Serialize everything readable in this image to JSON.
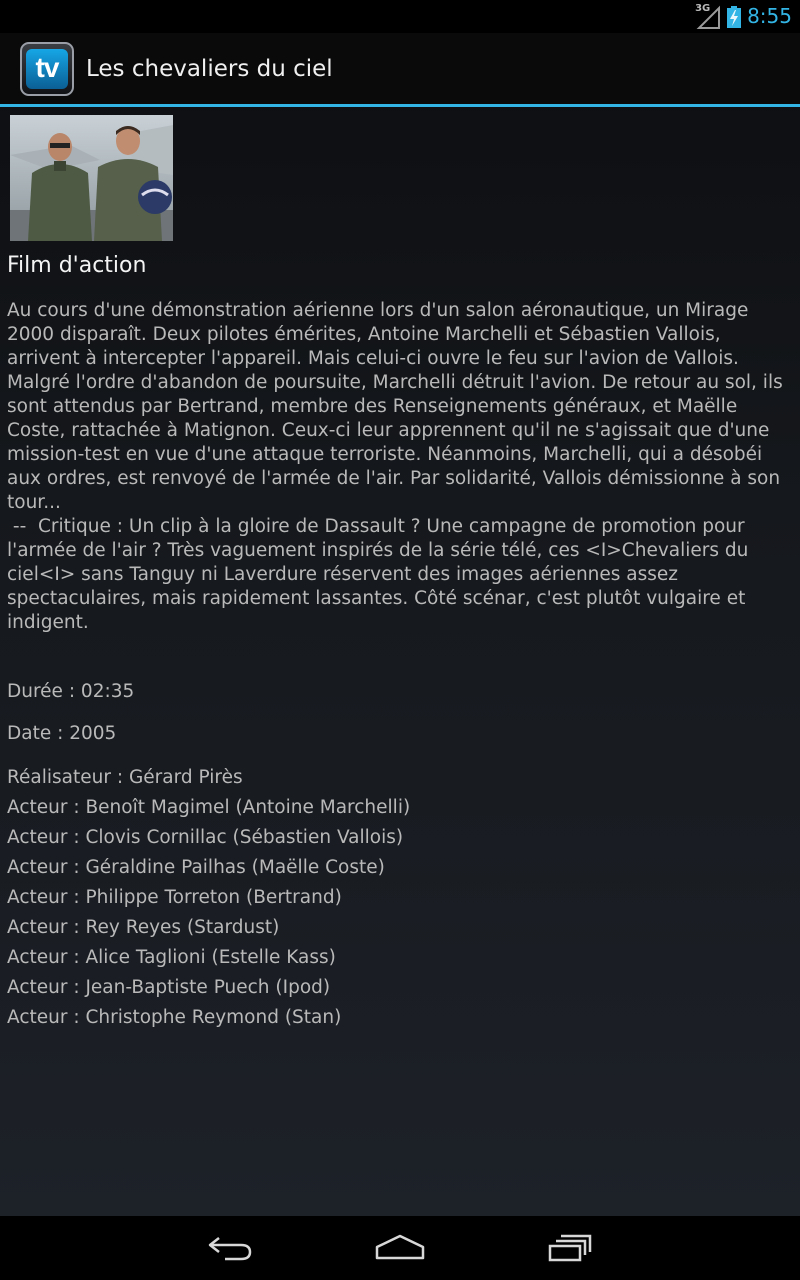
{
  "status_bar": {
    "network_label": "3G",
    "time": "8:55",
    "accent_color": "#33b5e5"
  },
  "action_bar": {
    "app_icon_text": "tv",
    "title": "Les chevaliers du ciel"
  },
  "movie": {
    "poster_icon": "movie-still-image",
    "genre": "Film d'action",
    "synopsis": "Au cours d'une démonstration aérienne lors d'un salon aéronautique, un Mirage 2000 disparaît. Deux pilotes émérites, Antoine Marchelli et Sébastien Vallois, arrivent à intercepter l'appareil. Mais celui-ci ouvre le feu sur l'avion de Vallois. Malgré l'ordre d'abandon de poursuite, Marchelli détruit l'avion. De retour au sol, ils sont attendus par Bertrand, membre des Renseignements généraux, et Maëlle Coste, rattachée à Matignon. Ceux-ci leur apprennent qu'il ne s'agissait que d'une mission-test en vue d'une attaque terroriste. Néanmoins, Marchelli, qui a désobéi aux ordres, est renvoyé de l'armée de l'air. Par solidarité, Vallois démissionne à son tour...\n --  Critique : Un clip à la gloire de Dassault ? Une campagne de promotion pour l'armée de l'air ? Très vaguement inspirés de la série télé, ces <I>Chevaliers du ciel<I> sans Tanguy ni Laverdure réservent des images aériennes assez spectaculaires, mais rapidement lassantes. Côté scénar, c'est plutôt vulgaire et indigent.",
    "duration": "Durée : 02:35",
    "date": "Date : 2005",
    "credits": [
      "Réalisateur : Gérard Pirès",
      "Acteur : Benoît Magimel (Antoine Marchelli)",
      "Acteur : Clovis Cornillac (Sébastien Vallois)",
      "Acteur : Géraldine Pailhas (Maëlle Coste)",
      "Acteur : Philippe Torreton (Bertrand)",
      "Acteur : Rey Reyes (Stardust)",
      "Acteur : Alice Taglioni (Estelle Kass)",
      "Acteur : Jean-Baptiste Puech (Ipod)",
      "Acteur : Christophe Reymond (Stan)"
    ]
  },
  "nav_bar": {
    "back_icon": "back-icon",
    "home_icon": "home-icon",
    "recents_icon": "recents-icon"
  }
}
